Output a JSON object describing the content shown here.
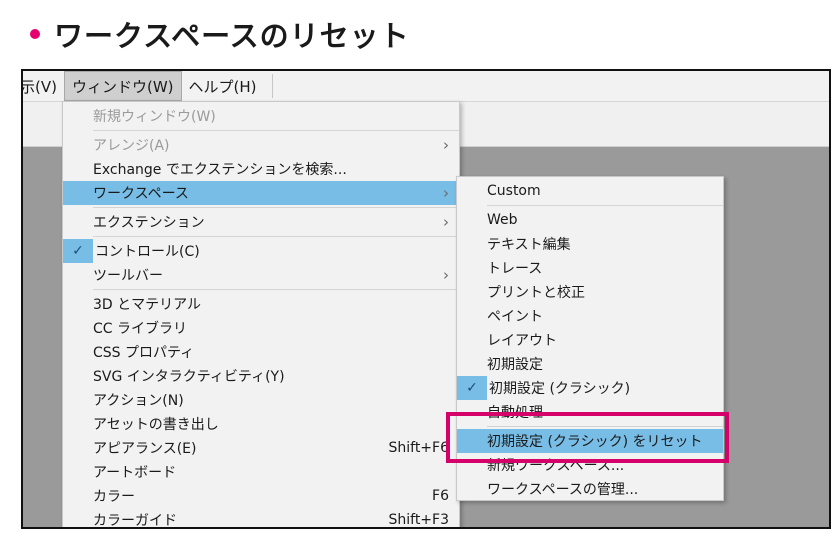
{
  "page": {
    "heading": "ワークスペースのリセット",
    "accent_color": "#e4006f"
  },
  "menubar": {
    "items": [
      {
        "id": "view",
        "label": "示(V)"
      },
      {
        "id": "window",
        "label": "ウィンドウ(W)"
      },
      {
        "id": "help",
        "label": "ヘルプ(H)"
      }
    ]
  },
  "window_menu": {
    "items": [
      {
        "label": "新規ウィンドウ(W)",
        "disabled": true
      },
      {
        "label": "アレンジ(A)",
        "disabled": true,
        "submenu": true
      },
      {
        "label": "Exchange でエクステンションを検索..."
      },
      {
        "label": "ワークスペース",
        "submenu": true,
        "highlighted": true
      },
      {
        "label": "エクステンション",
        "submenu": true
      },
      {
        "label": "コントロール(C)",
        "checked": true
      },
      {
        "label": "ツールバー",
        "submenu": true
      },
      {
        "label": "3D とマテリアル"
      },
      {
        "label": "CC ライブラリ"
      },
      {
        "label": "CSS プロパティ"
      },
      {
        "label": "SVG インタラクティビティ(Y)"
      },
      {
        "label": "アクション(N)"
      },
      {
        "label": "アセットの書き出し"
      },
      {
        "label": "アピアランス(E)",
        "shortcut": "Shift+F6"
      },
      {
        "label": "アートボード"
      },
      {
        "label": "カラー",
        "shortcut": "F6"
      },
      {
        "label": "カラーガイド",
        "shortcut": "Shift+F3"
      }
    ],
    "arrow_glyph": "›"
  },
  "workspace_submenu": {
    "items": [
      {
        "label": "Custom"
      },
      {
        "label": "Web"
      },
      {
        "label": "テキスト編集"
      },
      {
        "label": "トレース"
      },
      {
        "label": "プリントと校正"
      },
      {
        "label": "ペイント"
      },
      {
        "label": "レイアウト"
      },
      {
        "label": "初期設定"
      },
      {
        "label": "初期設定 (クラシック)",
        "checked": true
      },
      {
        "label": "自動処理"
      },
      {
        "label": "初期設定 (クラシック) をリセット",
        "highlighted": true
      },
      {
        "label": "新規ワークスペース..."
      },
      {
        "label": "ワークスペースの管理..."
      }
    ]
  },
  "check_glyph": "✓",
  "colors": {
    "highlight": "#78bde6",
    "callout_border": "#d6006b",
    "canvas": "#9a9a9a"
  }
}
